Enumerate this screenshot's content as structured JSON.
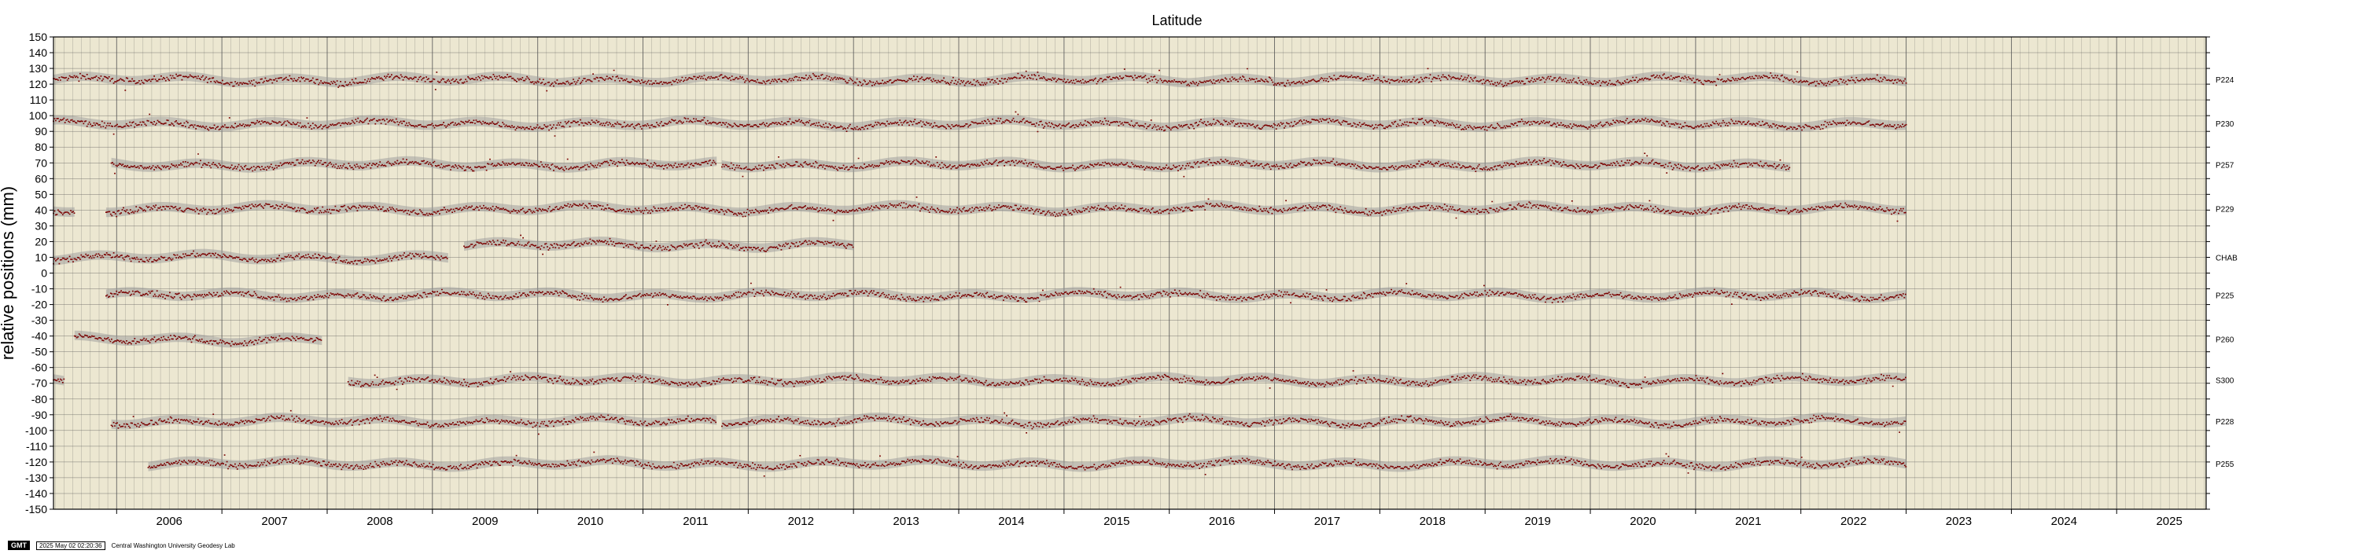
{
  "footer": {
    "badge": "GMT",
    "timestamp": "2025 May 02 02:20:36",
    "credit": "Central Washington University Geodesy Lab"
  },
  "chart_data": {
    "type": "scatter",
    "title": "Latitude",
    "ylabel": "relative positions (mm)",
    "xlabel": "",
    "xlim": [
      2005.4,
      2025.85
    ],
    "ylim": [
      -150,
      150
    ],
    "ytick_step": 10,
    "xtick_labels": [
      "2006",
      "2007",
      "2008",
      "2009",
      "2010",
      "2011",
      "2012",
      "2013",
      "2014",
      "2015",
      "2016",
      "2017",
      "2018",
      "2019",
      "2020",
      "2021",
      "2022",
      "2023",
      "2024",
      "2025"
    ],
    "grid": true,
    "colors": {
      "background": "#ece7d1",
      "points": "#7a0000",
      "envelope": "#9a9a9a",
      "grid": "#555555"
    },
    "series": [
      {
        "name": "P224",
        "segments": [
          [
            2005.4,
            2023.0
          ]
        ],
        "level": 123
      },
      {
        "name": "P230",
        "segments": [
          [
            2005.4,
            2023.0
          ]
        ],
        "level": 95
      },
      {
        "name": "P257",
        "segments": [
          [
            2005.95,
            2011.7
          ],
          [
            2011.75,
            2021.9
          ]
        ],
        "level": 69
      },
      {
        "name": "P229",
        "segments": [
          [
            2005.4,
            2005.6
          ],
          [
            2005.9,
            2023.0
          ]
        ],
        "level": 41
      },
      {
        "name": "CHAB",
        "segments": [
          [
            2005.4,
            2009.15
          ],
          [
            2009.3,
            2013.0
          ]
        ],
        "level": 10
      },
      {
        "name": "P225",
        "segments": [
          [
            2005.9,
            2023.0
          ]
        ],
        "level": -14
      },
      {
        "name": "P260",
        "segments": [
          [
            2005.6,
            2007.95
          ]
        ],
        "level": -42
      },
      {
        "name": "S300",
        "segments": [
          [
            2005.4,
            2005.5
          ],
          [
            2008.2,
            2023.0
          ]
        ],
        "level": -68
      },
      {
        "name": "P228",
        "segments": [
          [
            2005.95,
            2011.7
          ],
          [
            2011.75,
            2023.0
          ]
        ],
        "level": -94
      },
      {
        "name": "P255",
        "segments": [
          [
            2006.3,
            2023.0
          ]
        ],
        "level": -121
      }
    ]
  }
}
